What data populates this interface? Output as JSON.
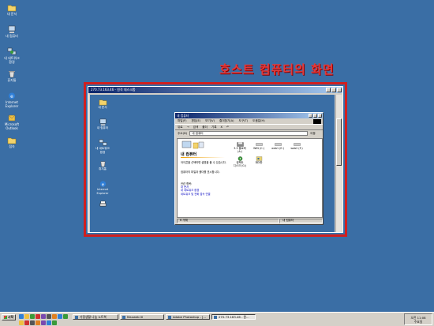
{
  "host_desktop": {
    "icons": [
      {
        "label": "내 문서",
        "icon": "folder-icon"
      },
      {
        "label": "내 컴퓨터",
        "icon": "computer-icon"
      },
      {
        "label": "내 네트워크\n환경",
        "icon": "network-icon"
      },
      {
        "label": "휴지통",
        "icon": "trash-icon"
      },
      {
        "label": "Internet\nExplorer",
        "icon": "ie-icon"
      },
      {
        "label": "Microsoft\nOutlook",
        "icon": "outlook-icon"
      },
      {
        "label": "접속",
        "icon": "folder-icon"
      }
    ]
  },
  "annotation": {
    "text": "호스트 컴퓨터의 화면",
    "color": "#e23a3a"
  },
  "remote_window": {
    "title": "270.73.163.46 - 원격 데스크톱",
    "icons": [
      {
        "label": "내 문서",
        "icon": "folder-icon"
      },
      {
        "label": "내 컴퓨터",
        "icon": "computer-icon"
      },
      {
        "label": "내 네트워크\n환경",
        "icon": "network-icon"
      },
      {
        "label": "휴지통",
        "icon": "trash-icon"
      },
      {
        "label": "Internet\nExplorer",
        "icon": "ie-icon"
      },
      {
        "label": "",
        "icon": "printer-icon"
      }
    ]
  },
  "my_computer": {
    "title": "내 컴퓨터",
    "menu": [
      "파일(F)",
      "편집(E)",
      "보기(V)",
      "즐겨찾기(A)",
      "도구(T)",
      "도움말(H)"
    ],
    "toolbar": [
      "뒤로",
      "→",
      "검색",
      "폴더",
      "기록",
      "X",
      "↶"
    ],
    "address_label": "주소(D)",
    "address_value": "내 컴퓨터",
    "go_label": "이동",
    "heading": "내 컴퓨터",
    "description": "아이콘을 선택하면 설명을 볼 수 있습니다.",
    "description2": "컴퓨터의 파일과 폴더를 표시합니다.",
    "links_heading": "관련 항목:",
    "links": [
      "내 문서",
      "내 네트워크 환경",
      "네트워크 및 전화 접속 연결"
    ],
    "items": [
      {
        "label": "3.5 플로피\n(A:)",
        "icon": "floppy-icon"
      },
      {
        "label": "WIN (C:)",
        "icon": "drive-icon"
      },
      {
        "label": "web1 (E:)",
        "icon": "drive-icon"
      },
      {
        "label": "web2 (F:)",
        "icon": "drive-icon"
      },
      {
        "label": "컴팩트\n디스크 (G:)",
        "icon": "cdrom-icon"
      },
      {
        "label": "제어판",
        "icon": "control-panel-icon"
      }
    ],
    "status_left": "6 개체",
    "status_right": "내 컴퓨터"
  },
  "taskbar": {
    "start_label": "시작",
    "tasks": [
      {
        "label": "가정생활 나눔 노트북"
      },
      {
        "label": "Maxweb III"
      },
      {
        "label": "Adobe Photoshop - [..."
      },
      {
        "label": "270.73.163.46 - 원..."
      }
    ],
    "tray_time": "오전 11:08",
    "tray_day": "수요일"
  },
  "colors": {
    "desktop": "#3a6ea5",
    "annotation": "#e23a3a",
    "frame": "#d01f1f",
    "titlebar": "#0a246a"
  }
}
